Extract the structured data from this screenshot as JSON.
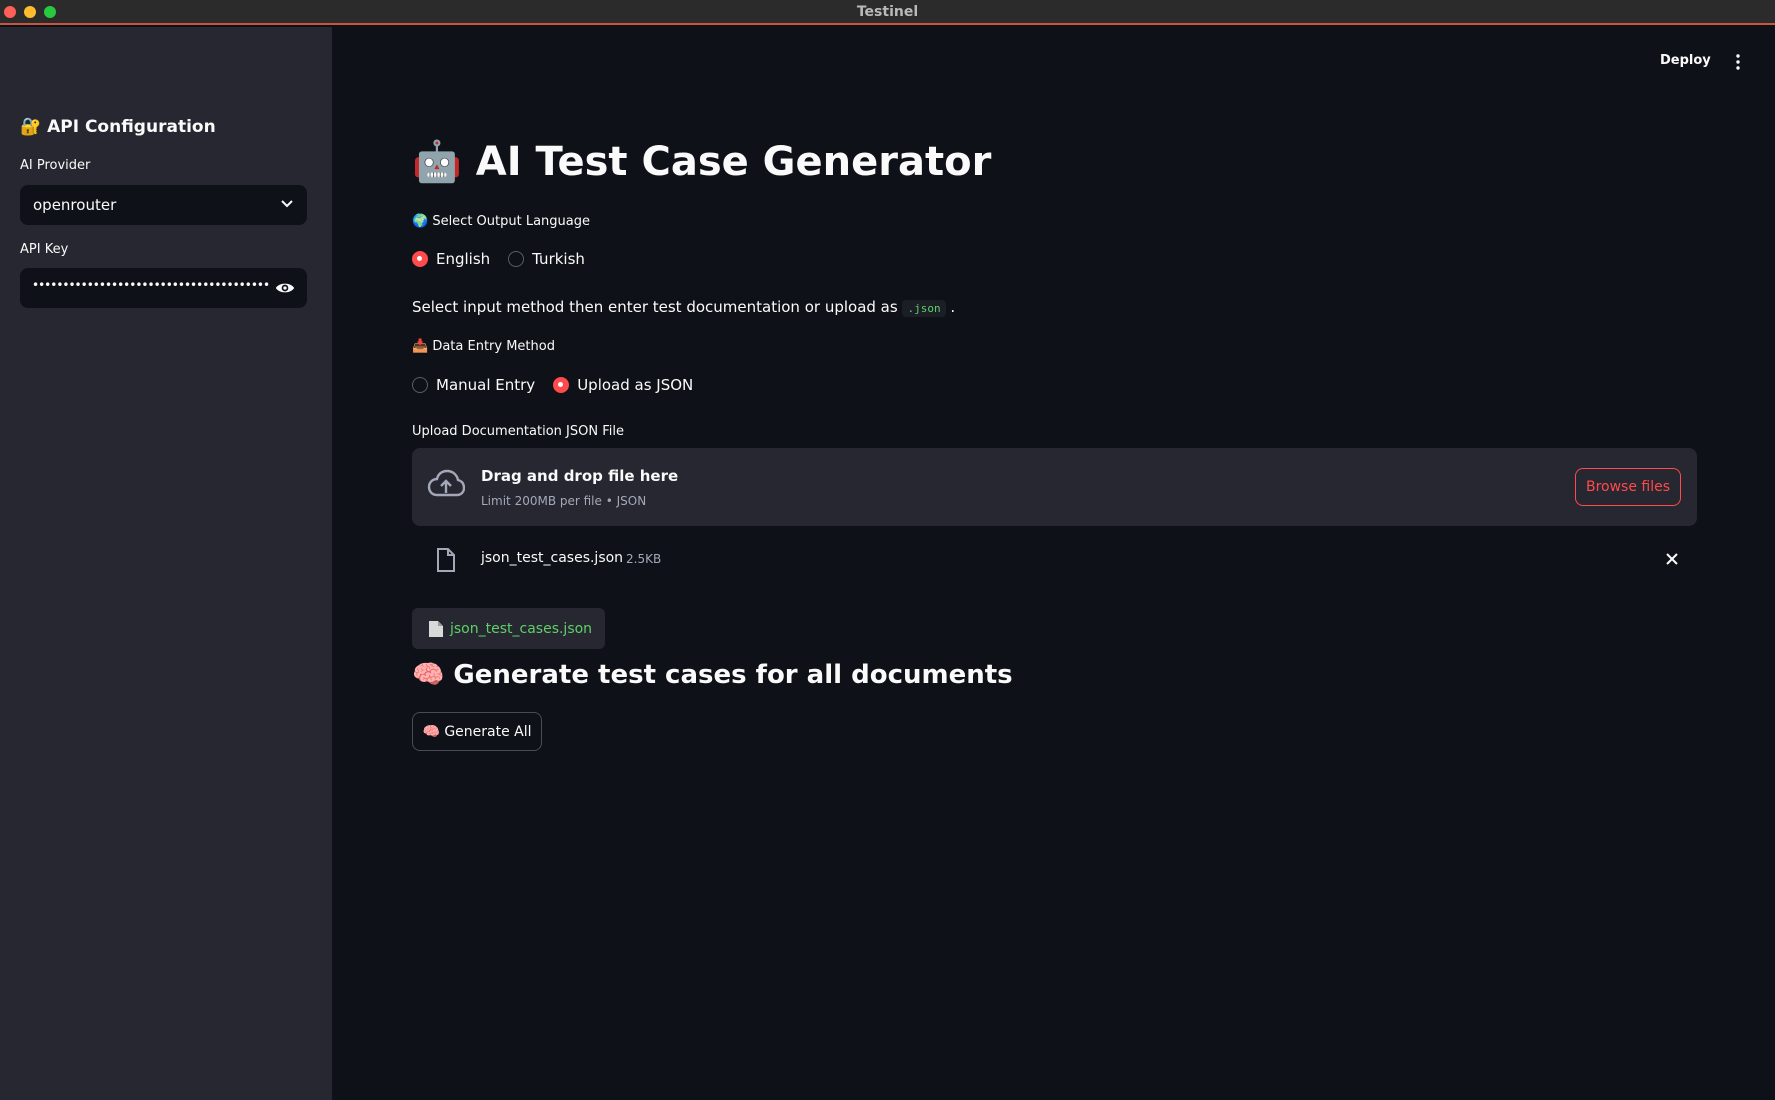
{
  "window": {
    "title": "Testinel"
  },
  "sidebar": {
    "heading_icon": "🔐",
    "heading": "API Configuration",
    "provider_label": "AI Provider",
    "provider_value": "openrouter",
    "api_key_label": "API Key",
    "api_key_masked": "••••••••••••••••••••••••••••••••••••••••••••••••••"
  },
  "toolbar": {
    "deploy_label": "Deploy"
  },
  "main": {
    "title_icon": "🤖",
    "title": "AI Test Case Generator",
    "language_label": "🌍 Select Output Language",
    "language_options": [
      "English",
      "Turkish"
    ],
    "language_selected": "English",
    "instruction_text": "Select input method then enter test documentation or upload as",
    "instruction_code": ".json",
    "instruction_end": ".",
    "entry_method_label": "📥 Data Entry Method",
    "entry_method_options": [
      "Manual Entry",
      "Upload as JSON"
    ],
    "entry_method_selected": "Upload as JSON",
    "upload_label": "Upload Documentation JSON File",
    "dropzone_title": "Drag and drop file here",
    "dropzone_sub": "Limit 200MB per file • JSON",
    "browse_label": "Browse files",
    "uploaded_file_name": "json_test_cases.json",
    "uploaded_file_size": "2.5KB",
    "chip_text": "json_test_cases.json",
    "section_heading": "🧠 Generate test cases for all documents",
    "generate_button": "🧠 Generate All"
  },
  "colors": {
    "accent": "#ff4b4b",
    "code_green": "#5fd068",
    "background": "#0e1117",
    "sidebar": "#262730"
  }
}
